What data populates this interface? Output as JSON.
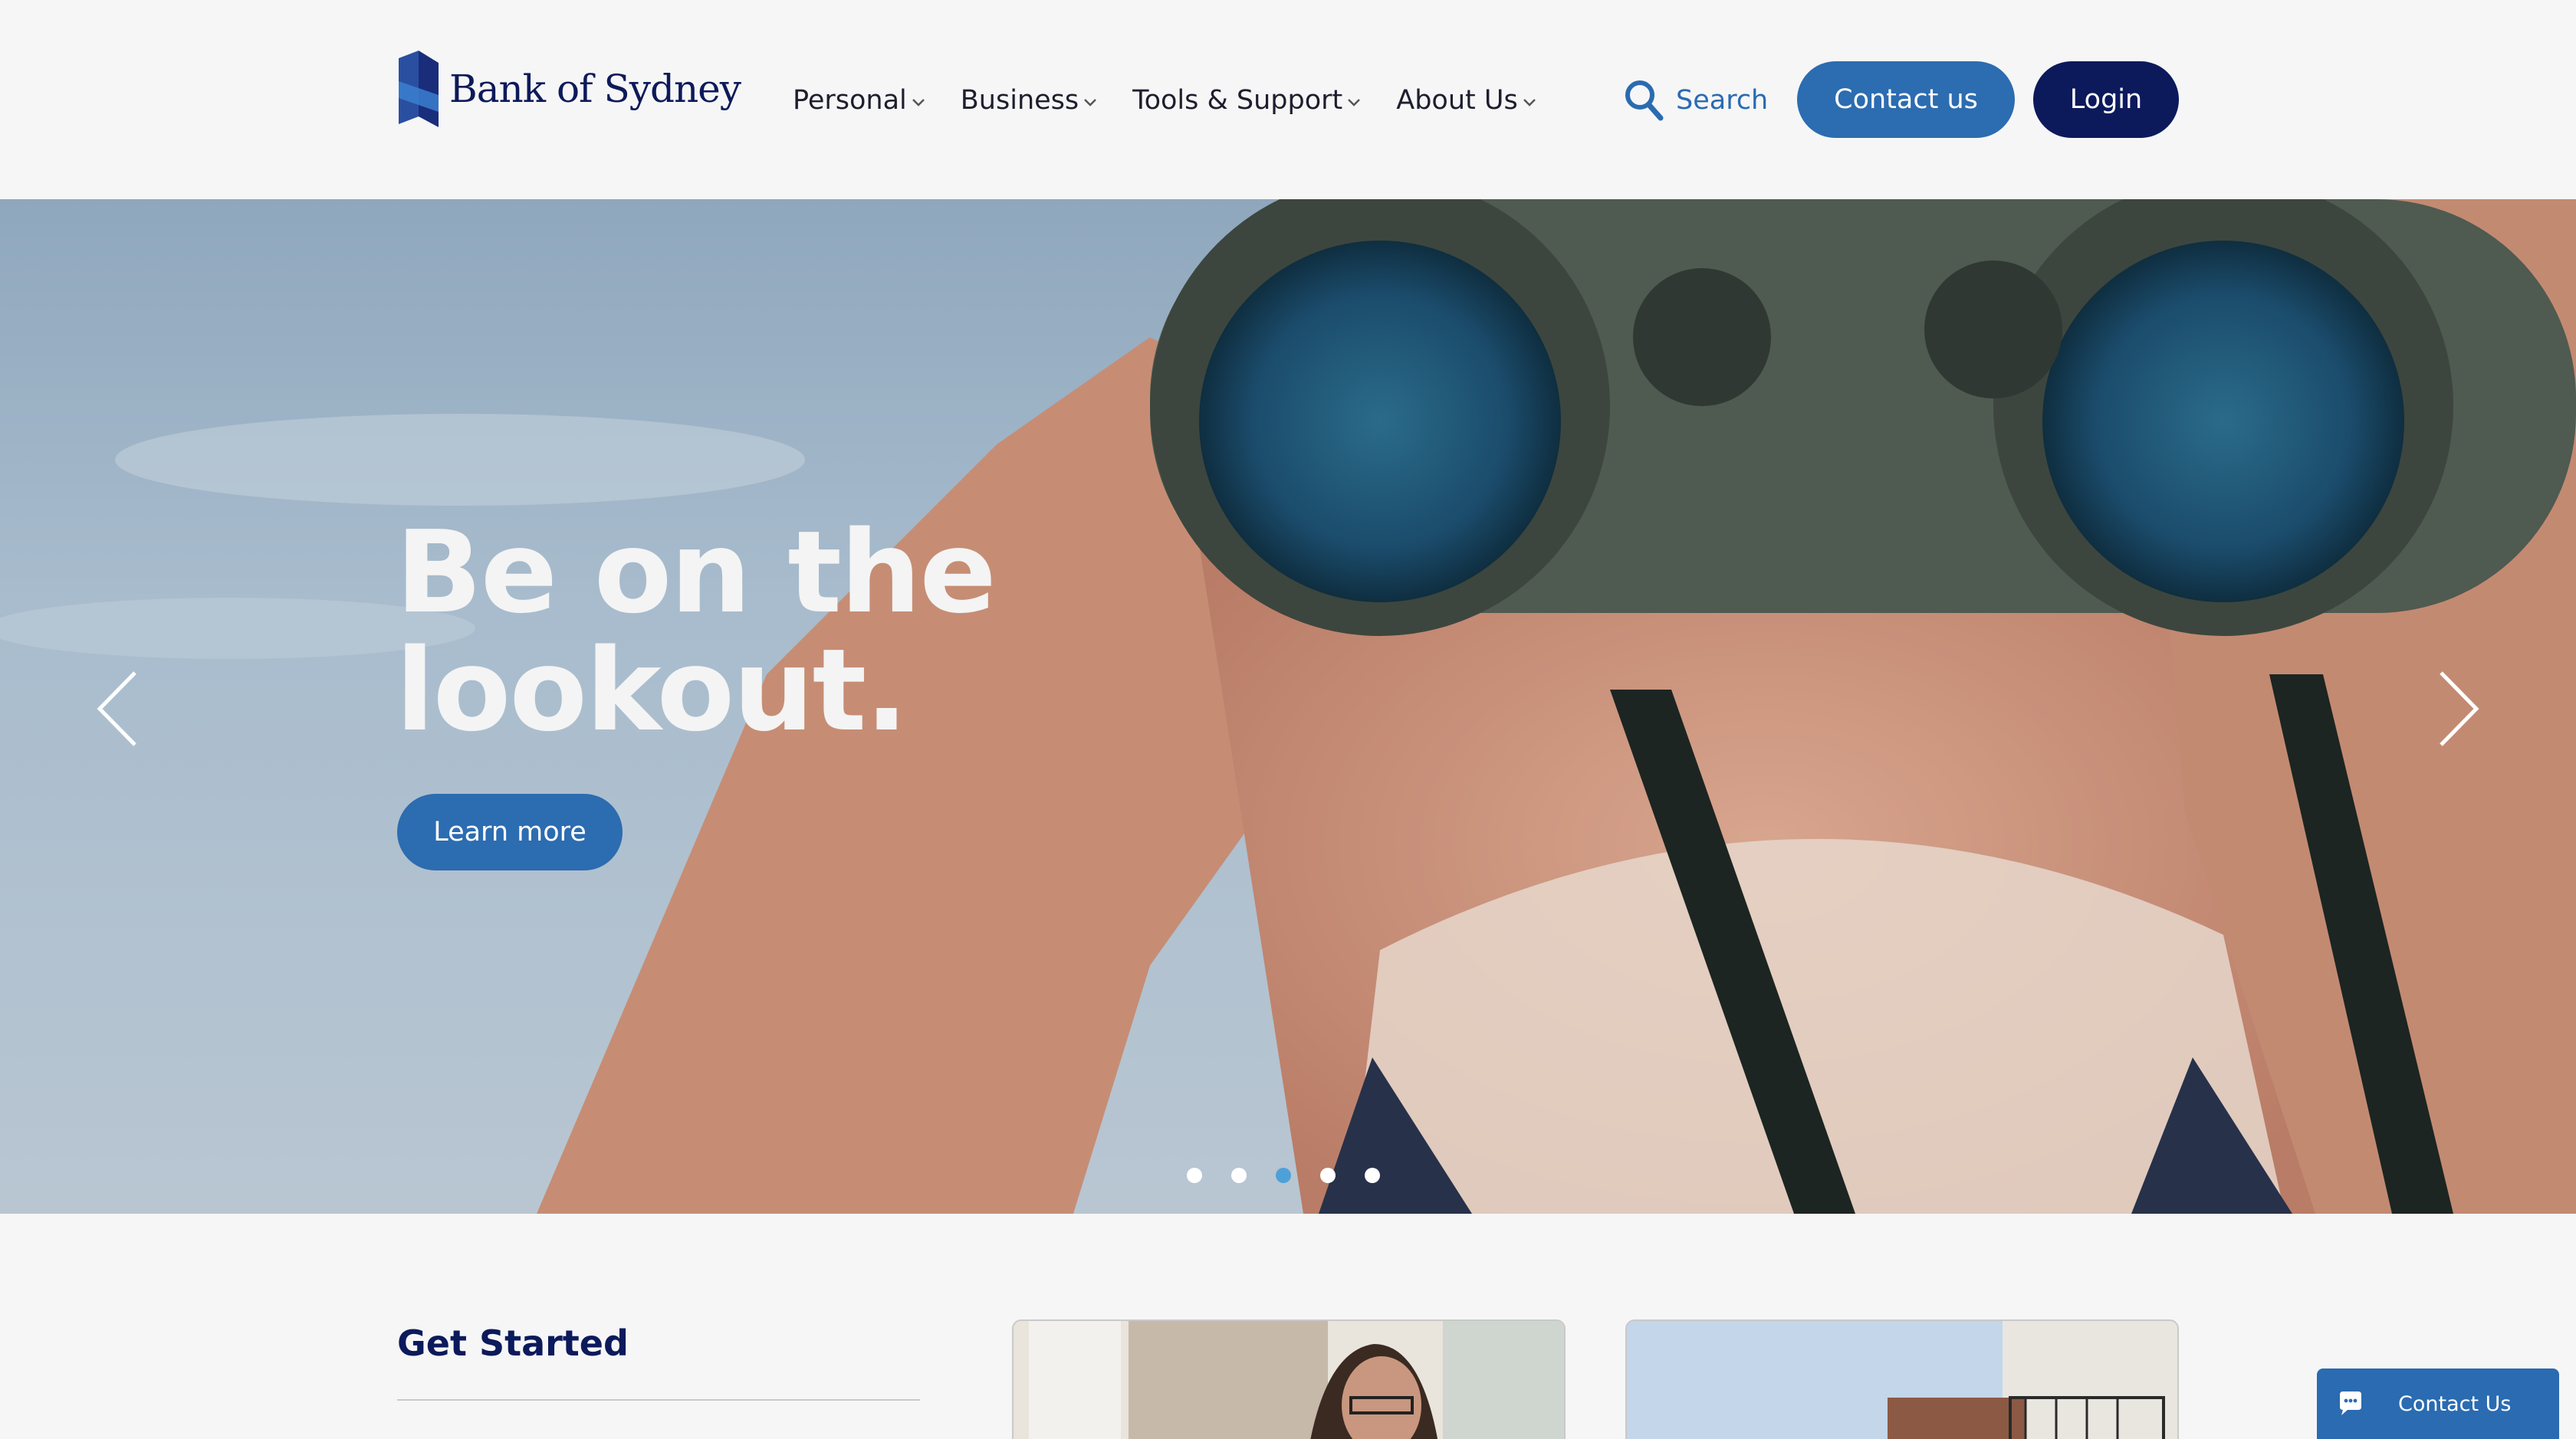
{
  "header": {
    "logo_text": "Bank of Sydney",
    "nav": [
      {
        "label": "Personal"
      },
      {
        "label": "Business"
      },
      {
        "label": "Tools & Support"
      },
      {
        "label": "About Us"
      }
    ],
    "search_label": "Search",
    "contact_label": "Contact us",
    "login_label": "Login"
  },
  "hero": {
    "title_line1": "Be on the",
    "title_line2": "lookout.",
    "cta_label": "Learn more",
    "slide_count": 5,
    "active_slide": 3
  },
  "main": {
    "section_title": "Get Started"
  },
  "chat": {
    "label": "Contact Us"
  },
  "icons": {
    "logo": "bank-of-sydney-logo",
    "search": "search-icon",
    "chevron": "chevron-down-icon",
    "prev": "chevron-left-icon",
    "next": "chevron-right-icon",
    "chat": "chat-bubble-icon"
  },
  "colors": {
    "brand_navy": "#0c1a5c",
    "brand_blue": "#2c6cb0",
    "dot_active": "#4ea1d8",
    "background": "#f6f6f6"
  }
}
